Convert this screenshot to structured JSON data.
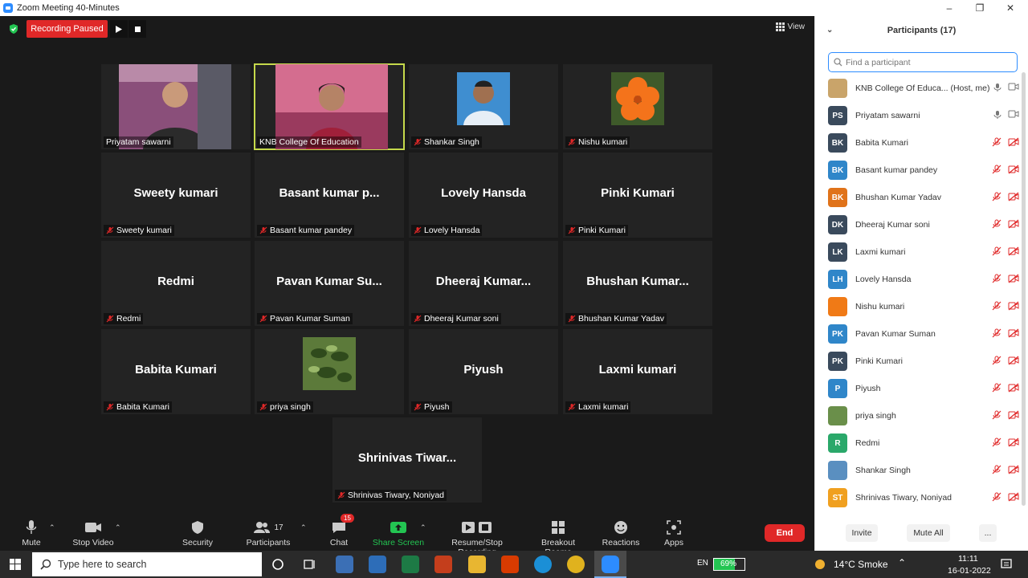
{
  "window": {
    "title": "Zoom Meeting 40-Minutes"
  },
  "recording": {
    "status": "Recording Paused"
  },
  "view_label": "View",
  "tiles": [
    {
      "name": "Priyatam sawarni",
      "big": "",
      "muted": false,
      "photo": "person"
    },
    {
      "name": "KNB College Of Education",
      "big": "",
      "muted": false,
      "photo": "woman",
      "active": true
    },
    {
      "name": "Shankar Singh",
      "big": "",
      "muted": true,
      "photo": "man"
    },
    {
      "name": "Nishu kumari",
      "big": "",
      "muted": true,
      "photo": "flower"
    },
    {
      "name": "Sweety kumari",
      "big": "Sweety kumari",
      "muted": true
    },
    {
      "name": "Basant kumar pandey",
      "big": "Basant kumar p...",
      "muted": true
    },
    {
      "name": "Lovely Hansda",
      "big": "Lovely Hansda",
      "muted": true
    },
    {
      "name": "Pinki Kumari",
      "big": "Pinki Kumari",
      "muted": true
    },
    {
      "name": "Redmi",
      "big": "Redmi",
      "muted": true
    },
    {
      "name": "Pavan Kumar Suman",
      "big": "Pavan Kumar Su...",
      "muted": true
    },
    {
      "name": "Dheeraj Kumar soni",
      "big": "Dheeraj  Kumar...",
      "muted": true
    },
    {
      "name": "Bhushan Kumar Yadav",
      "big": "Bhushan  Kumar...",
      "muted": true
    },
    {
      "name": "Babita Kumari",
      "big": "Babita Kumari",
      "muted": true
    },
    {
      "name": "priya singh",
      "big": "",
      "muted": true,
      "photo": "plant"
    },
    {
      "name": "Piyush",
      "big": "Piyush",
      "muted": true
    },
    {
      "name": "Laxmi kumari",
      "big": "Laxmi kumari",
      "muted": true
    },
    {
      "name": "Shrinivas Tiwary, Noniyad",
      "big": "Shrinivas  Tiwar...",
      "muted": true
    }
  ],
  "toolbar": {
    "mute": "Mute",
    "stop_video": "Stop Video",
    "security": "Security",
    "participants": "Participants",
    "participants_count": "17",
    "chat": "Chat",
    "chat_badge": "15",
    "share_screen": "Share Screen",
    "recording": "Resume/Stop Recording",
    "breakout": "Breakout Rooms",
    "reactions": "Reactions",
    "apps": "Apps",
    "end": "End"
  },
  "panel": {
    "title": "Participants (17)",
    "search_placeholder": "Find a participant",
    "participants": [
      {
        "name": "KNB College Of Educa...  (Host, me)",
        "initials": "",
        "color": "#c9a46a",
        "photo": true,
        "muted": false
      },
      {
        "name": "Priyatam sawarni",
        "initials": "PS",
        "color": "#3a4a5c",
        "muted": false
      },
      {
        "name": "Babita Kumari",
        "initials": "BK",
        "color": "#3a4a5c",
        "muted": true
      },
      {
        "name": "Basant kumar pandey",
        "initials": "BK",
        "color": "#2f86c9",
        "muted": true
      },
      {
        "name": "Bhushan Kumar Yadav",
        "initials": "BK",
        "color": "#e0731a",
        "muted": true
      },
      {
        "name": "Dheeraj Kumar soni",
        "initials": "DK",
        "color": "#3a4a5c",
        "muted": true
      },
      {
        "name": "Laxmi kumari",
        "initials": "LK",
        "color": "#3a4a5c",
        "muted": true
      },
      {
        "name": "Lovely Hansda",
        "initials": "LH",
        "color": "#2f86c9",
        "muted": true
      },
      {
        "name": "Nishu kumari",
        "initials": "",
        "color": "#f07a16",
        "photo": true,
        "muted": true
      },
      {
        "name": "Pavan Kumar Suman",
        "initials": "PK",
        "color": "#2f86c9",
        "muted": true
      },
      {
        "name": "Pinki Kumari",
        "initials": "PK",
        "color": "#3a4a5c",
        "muted": true
      },
      {
        "name": "Piyush",
        "initials": "P",
        "color": "#2f86c9",
        "muted": true
      },
      {
        "name": "priya singh",
        "initials": "",
        "color": "#6a8f4a",
        "photo": true,
        "muted": true
      },
      {
        "name": "Redmi",
        "initials": "R",
        "color": "#2aa86a",
        "muted": true
      },
      {
        "name": "Shankar Singh",
        "initials": "",
        "color": "#5a8fc0",
        "photo": true,
        "muted": true
      },
      {
        "name": "Shrinivas Tiwary, Noniyad",
        "initials": "ST",
        "color": "#f0a020",
        "muted": true
      }
    ],
    "invite": "Invite",
    "mute_all": "Mute All",
    "more": "..."
  },
  "taskbar": {
    "search_placeholder": "Type here to search",
    "lang": "EN",
    "battery": "69%",
    "weather": "14°C  Smoke",
    "time": "11:11",
    "date": "16-01-2022"
  }
}
